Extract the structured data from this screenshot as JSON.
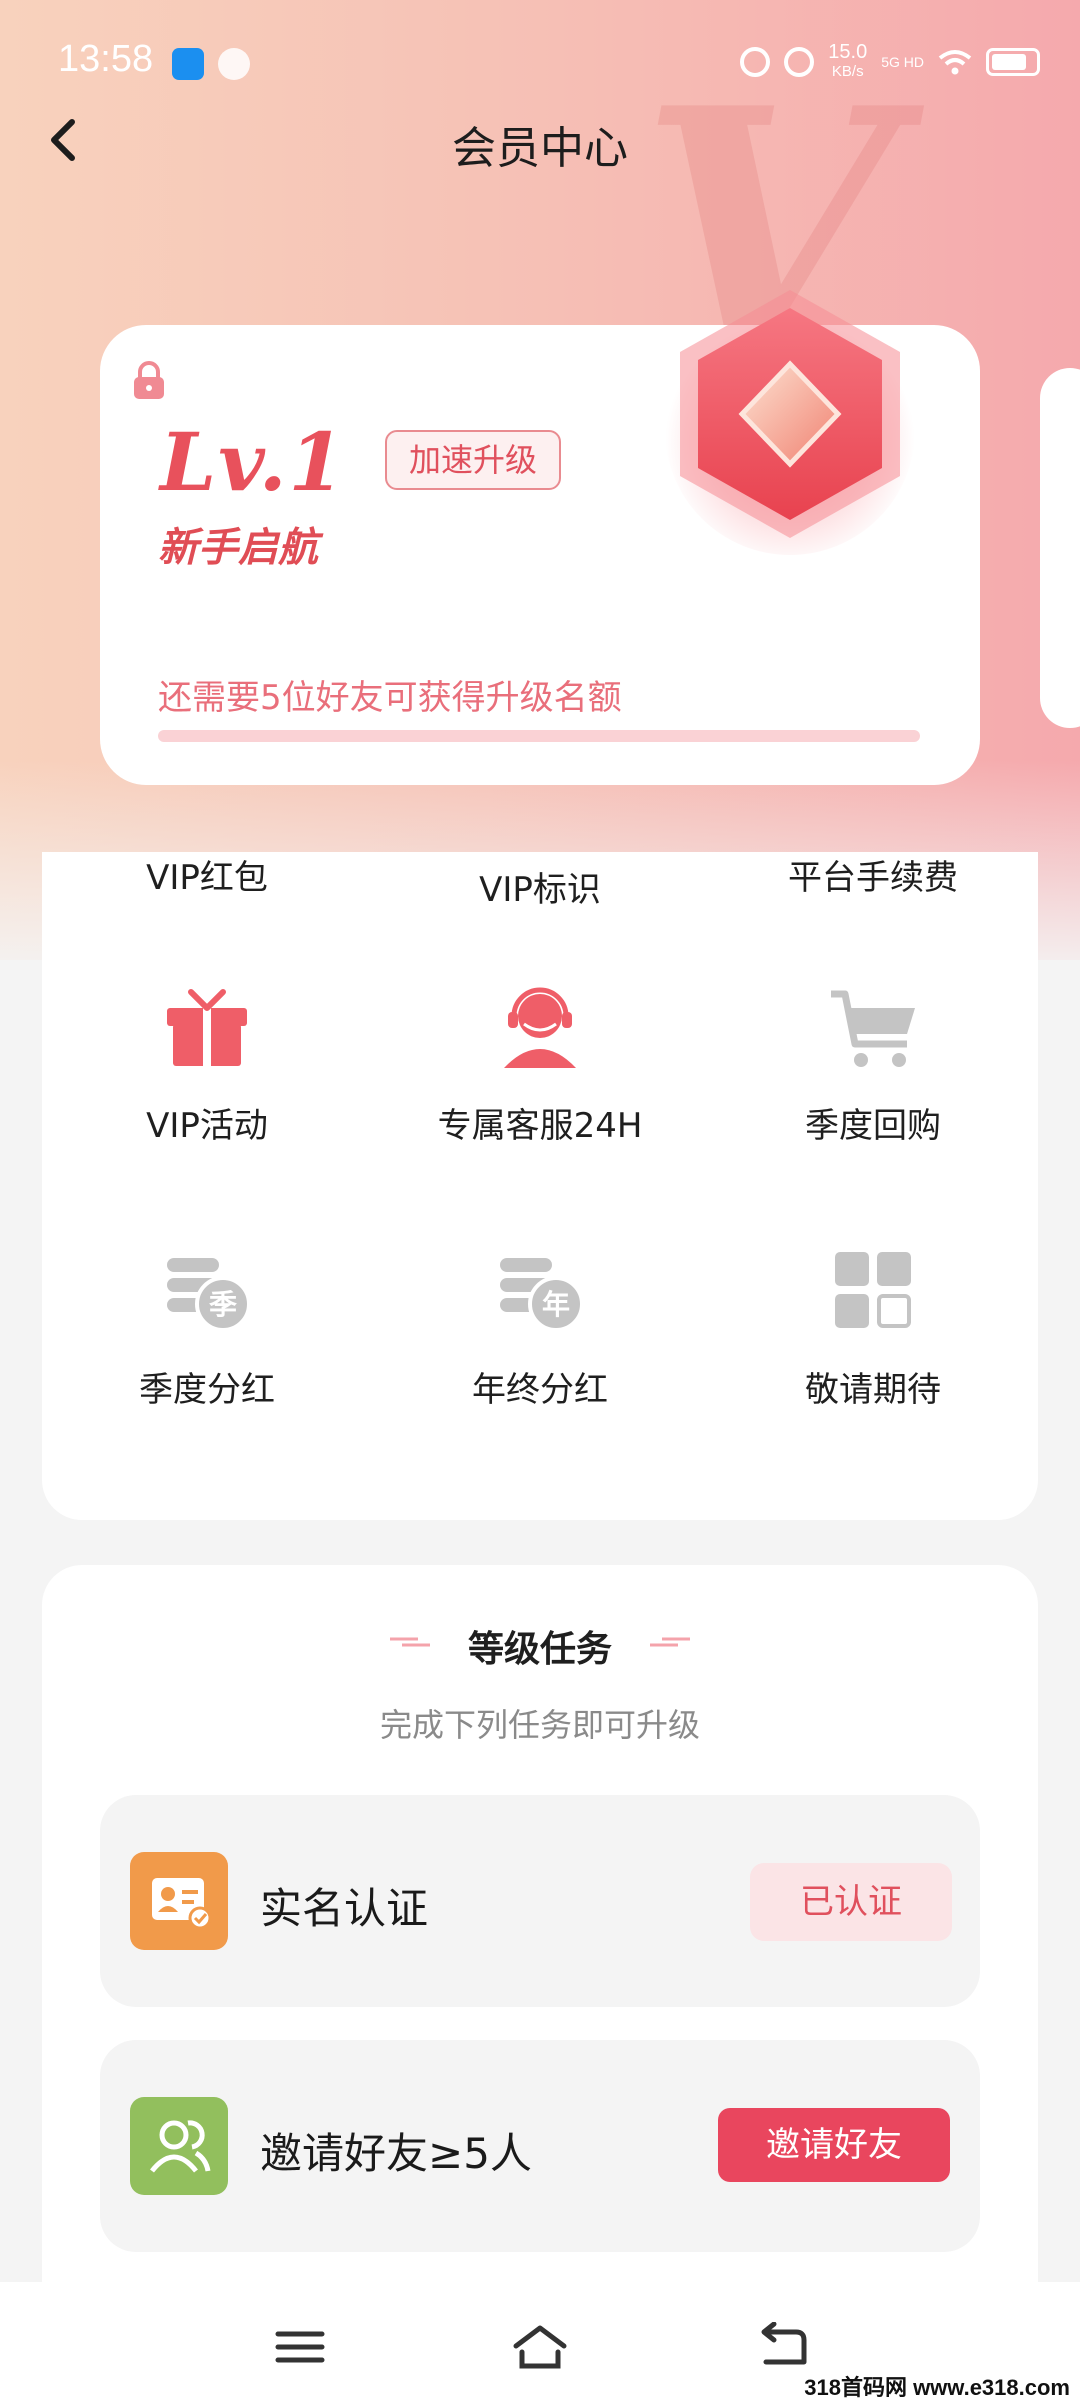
{
  "status_bar": {
    "time": "13:58",
    "speed_value": "15.0",
    "speed_unit": "KB/s",
    "network": "5G HD"
  },
  "nav": {
    "title": "会员中心",
    "back_icon": "chevron-left-icon"
  },
  "level_card": {
    "level": "Lv.1",
    "boost_button": "加速升级",
    "level_name": "新手启航",
    "progress_text": "还需要5位好友可获得升级名额",
    "progress_fraction": 0.0
  },
  "benefits": {
    "top_row": [
      "VIP红包",
      "VIP标识",
      "平台手续费"
    ],
    "items": [
      {
        "label": "VIP活动",
        "icon": "gift-icon"
      },
      {
        "label": "专属客服24H",
        "icon": "customer-service-icon"
      },
      {
        "label": "季度回购",
        "icon": "shopping-cart-icon"
      },
      {
        "label": "季度分红",
        "icon": "quarterly-dividend-icon"
      },
      {
        "label": "年终分红",
        "icon": "annual-dividend-icon"
      },
      {
        "label": "敬请期待",
        "icon": "grid-icon"
      }
    ],
    "coin_badges": [
      "季",
      "年"
    ]
  },
  "tasks": {
    "title": "等级任务",
    "subtitle": "完成下列任务即可升级",
    "items": [
      {
        "label": "实名认证",
        "button": "已认证",
        "icon": "id-card-icon",
        "icon_color": "#f19a4a"
      },
      {
        "label": "邀请好友≥5人",
        "button": "邀请好友",
        "icon": "friends-icon",
        "icon_color": "#92bf5d"
      }
    ]
  },
  "watermark": "318首码网 www.e318.com",
  "colors": {
    "accent": "#e9465e",
    "level_text": "#e8515c",
    "progress_text": "#e96f7b"
  }
}
